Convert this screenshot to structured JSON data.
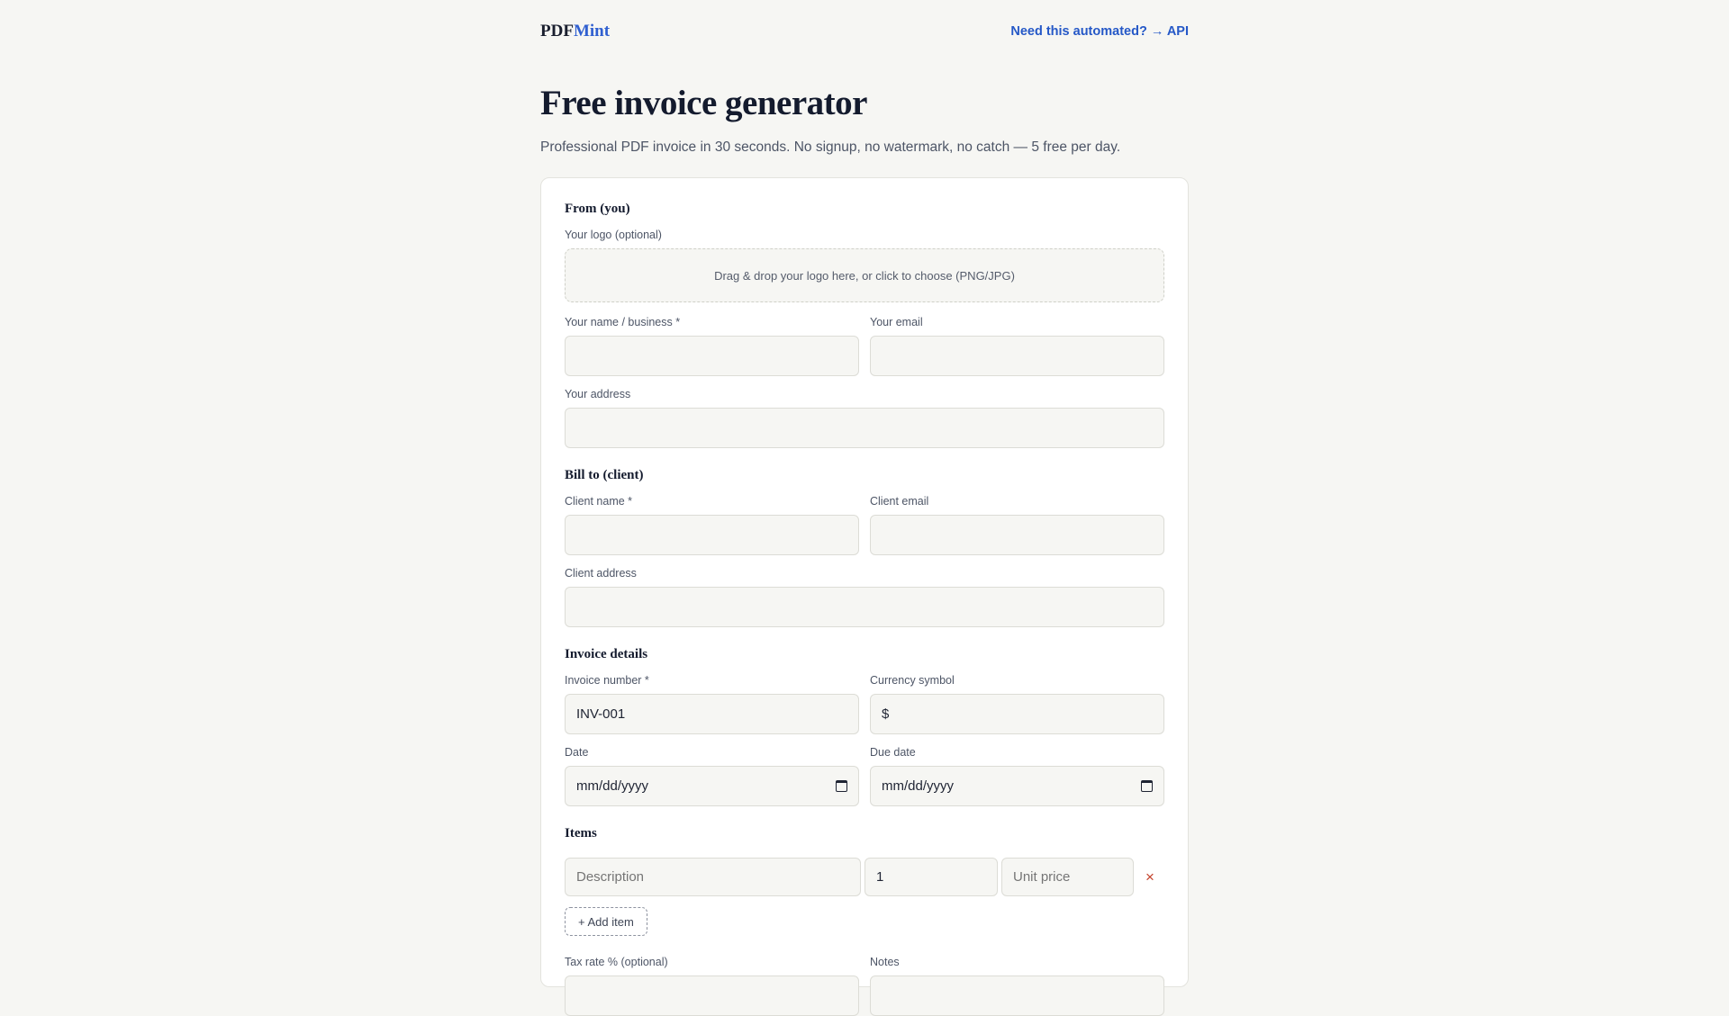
{
  "header": {
    "logo_part1": "PDF",
    "logo_part2": "Mint",
    "api_link": "Need this automated? → API"
  },
  "hero": {
    "title": "Free invoice generator",
    "subtitle": "Professional PDF invoice in 30 seconds. No signup, no watermark, no catch — 5 free per day."
  },
  "from": {
    "title": "From (you)",
    "logo_label": "Your logo (optional)",
    "dropzone_text": "Drag & drop your logo here, or click to choose (PNG/JPG)",
    "name_label": "Your name / business *",
    "email_label": "Your email",
    "address_label": "Your address"
  },
  "bill_to": {
    "title": "Bill to (client)",
    "name_label": "Client name *",
    "email_label": "Client email",
    "address_label": "Client address"
  },
  "details": {
    "title": "Invoice details",
    "number_label": "Invoice number *",
    "number_value": "INV-001",
    "currency_label": "Currency symbol",
    "currency_value": "$",
    "date_label": "Date",
    "date_value": "mm/dd/yyyy",
    "due_label": "Due date",
    "due_value": "mm/dd/yyyy"
  },
  "items": {
    "title": "Items",
    "description_placeholder": "Description",
    "quantity_value": "1",
    "price_placeholder": "Unit price",
    "remove_symbol": "×",
    "add_label": "+ Add item"
  },
  "extras": {
    "tax_label": "Tax rate % (optional)",
    "notes_label": "Notes"
  },
  "colors": {
    "accent": "#2f5fd0",
    "link": "#2558c7",
    "danger": "#c4412a",
    "background": "#f6f6f3"
  }
}
